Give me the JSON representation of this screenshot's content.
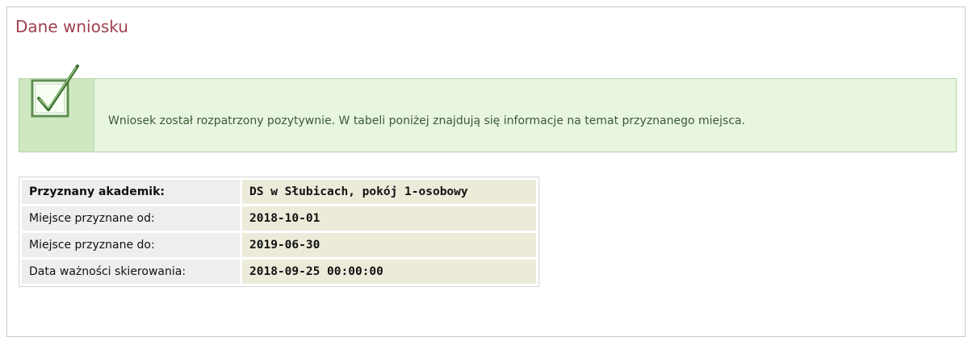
{
  "section": {
    "title": "Dane wniosku"
  },
  "notice": {
    "icon": "checkmark-icon",
    "text": "Wniosek został rozpatrzony pozytywnie. W tabeli poniżej znajdują się informacje na temat przyznanego miejsca."
  },
  "table": {
    "rows": [
      {
        "label": "Przyznany akademik:",
        "value": "DS w Słubicach, pokój 1-osobowy"
      },
      {
        "label": "Miejsce przyznane od:",
        "value": "2018-10-01"
      },
      {
        "label": "Miejsce przyznane do:",
        "value": "2019-06-30"
      },
      {
        "label": "Data ważności skierowania:",
        "value": "2018-09-25 00:00:00"
      }
    ]
  },
  "colors": {
    "title": "#a0414f",
    "notice_bg": "#e8f5e0",
    "notice_border": "#b5d3a8",
    "value_bg": "#ecebda",
    "label_bg": "#eeeeee"
  }
}
